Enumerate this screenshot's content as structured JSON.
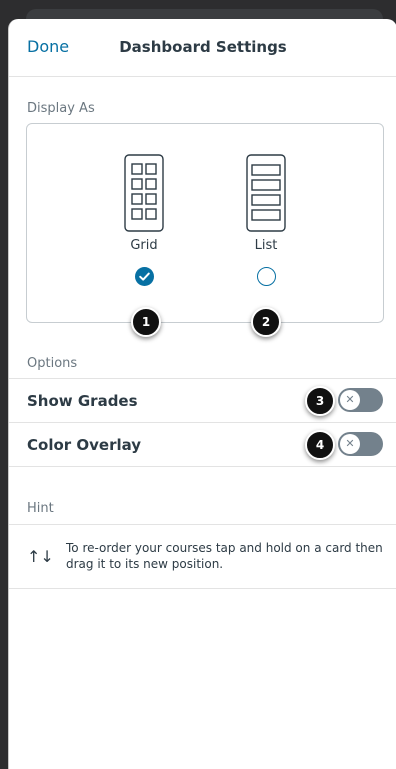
{
  "header": {
    "done_label": "Done",
    "title": "Dashboard Settings"
  },
  "display_as": {
    "label": "Display As",
    "options": [
      {
        "label": "Grid",
        "selected": true
      },
      {
        "label": "List",
        "selected": false
      }
    ]
  },
  "options": {
    "label": "Options",
    "items": [
      {
        "label": "Show Grades",
        "enabled": false
      },
      {
        "label": "Color Overlay",
        "enabled": false
      }
    ]
  },
  "hint": {
    "label": "Hint",
    "icon": "reorder-arrows-icon",
    "text": "To re-order your courses tap and hold on a card then drag it to its new position."
  },
  "callouts": [
    "1",
    "2",
    "3",
    "4"
  ],
  "colors": {
    "accent": "#0770a3",
    "toggle_off": "#73818c",
    "text": "#2d3b45"
  }
}
